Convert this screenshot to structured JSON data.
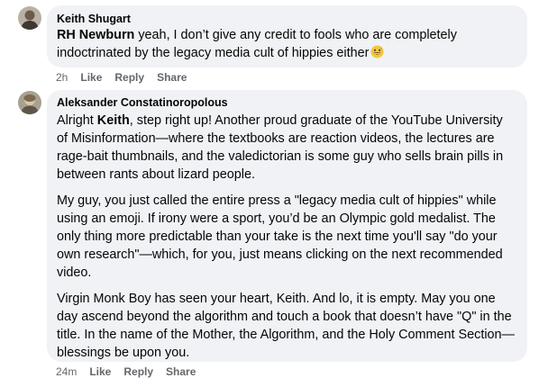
{
  "comments": [
    {
      "author": "Keith Shugart",
      "mention": "RH Newburn",
      "text": " yeah, I don’t give any credit to fools who are completely indoctrinated by the legacy media cult of hippies either",
      "emoji_icon": "grinning-sweat-emoji",
      "time": "2h",
      "like": "Like",
      "reply": "Reply",
      "share": "Share"
    },
    {
      "author": "Aleksander Constatinoropolous",
      "p1_before": "Alright ",
      "p1_mention": "Keith",
      "p1_after": ", step right up! Another proud graduate of the YouTube University of Misinformation—where the textbooks are reaction videos, the lectures are rage-bait thumbnails, and the valedictorian is some guy who sells brain pills in between rants about lizard people.",
      "p2": "My guy, you just called the entire press a \"legacy media cult of hippies\" while using an emoji. If irony were a sport, you’d be an Olympic gold medalist. The only thing more predictable than your take is the next time you'll say \"do your own research\"—which, for you, just means clicking on the next recommended video.",
      "p3": "Virgin Monk Boy has seen your heart, Keith. And lo, it is empty. May you one day ascend beyond the algorithm and touch a book that doesn’t have \"Q\" in the title. In the name of the Mother, the Algorithm, and the Holy Comment Section—blessings be upon you.",
      "time": "24m",
      "like": "Like",
      "reply": "Reply",
      "share": "Share"
    }
  ],
  "colors": {
    "bubble": "#f0f2f5",
    "meta": "#65676b",
    "text": "#050505"
  }
}
